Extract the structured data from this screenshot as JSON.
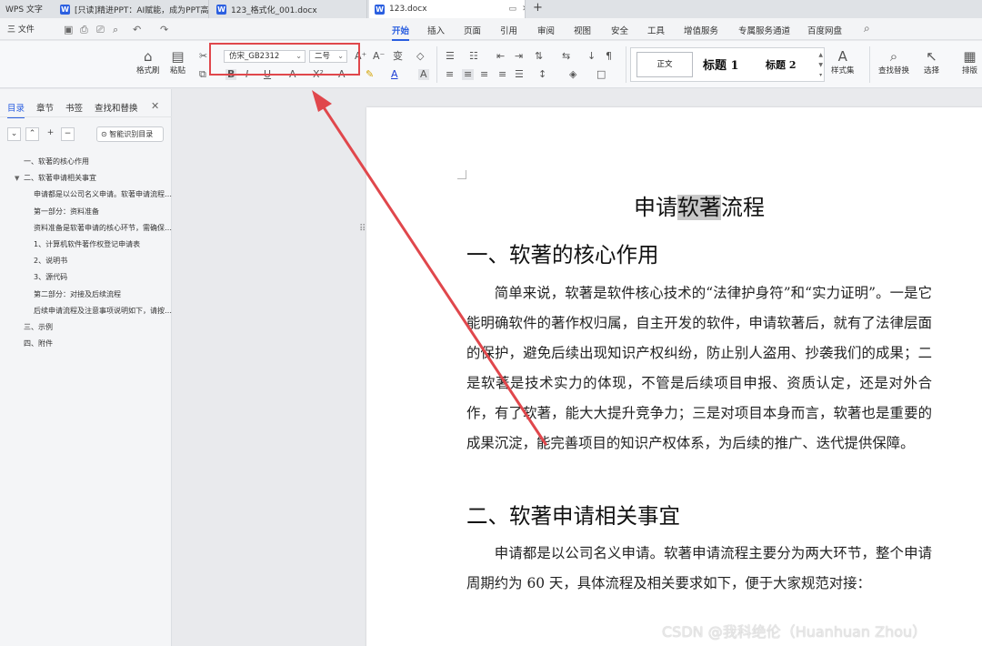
{
  "app_name": "WPS 文字",
  "tabs": [
    {
      "label": "[只读]精进PPT：AI赋能，成为PPT高手",
      "icon": "W"
    },
    {
      "label": "123_格式化_001.docx",
      "icon": "W"
    },
    {
      "label": "123.docx",
      "icon": "W",
      "active": true
    }
  ],
  "menu": {
    "file_label": "三 文件",
    "tabs": [
      "开始",
      "插入",
      "页面",
      "引用",
      "审阅",
      "视图",
      "安全",
      "工具",
      "增值服务",
      "专属服务通道",
      "百度网盘"
    ],
    "active_tab": "开始"
  },
  "ribbon": {
    "format_painter": "格式刷",
    "paste": "粘贴",
    "font_name": "仿宋_GB2312",
    "font_size": "二号",
    "style_normal": "正文",
    "style_h1": "标题 1",
    "style_h2": "标题 2",
    "style_set": "样式集",
    "find_replace": "查找替换",
    "select": "选择",
    "layout": "排版"
  },
  "nav": {
    "tabs": [
      "目录",
      "章节",
      "书签",
      "查找和替换"
    ],
    "active_tab": "目录",
    "smart_toc": "智能识别目录",
    "items": [
      {
        "text": "一、软著的核心作用",
        "level": 1
      },
      {
        "text": "二、软著申请相关事宜",
        "level": 1,
        "expanded": true
      },
      {
        "text": "申请都是以公司名义申请。软著申请流程主要分为两大环节",
        "level": 2
      },
      {
        "text": "第一部分：资料准备",
        "level": 2
      },
      {
        "text": "资料准备是软著申请的核心环节，需确保材料完整规范",
        "level": 2
      },
      {
        "text": "1、计算机软件著作权登记申请表",
        "level": 2
      },
      {
        "text": "2、说明书",
        "level": 2
      },
      {
        "text": "3、源代码",
        "level": 2
      },
      {
        "text": "第二部分：对接及后续流程",
        "level": 2
      },
      {
        "text": "后续申请流程及注意事项说明如下，请按要求对接",
        "level": 2
      },
      {
        "text": "三、示例",
        "level": 1
      },
      {
        "text": "四、附件",
        "level": 1
      }
    ]
  },
  "document": {
    "title_before": "申请",
    "title_selected": "软著",
    "title_after": "流程",
    "h1_1": "一、软著的核心作用",
    "p1": "简单来说，软著是软件核心技术的“法律护身符”和“实力证明”。一是它能明确软件的著作权归属，自主开发的软件，申请软著后，就有了法律层面的保护，避免后续出现知识产权纠纷，防止别人盗用、抄袭我们的成果；二是软著是技术实力的体现，不管是后续项目申报、资质认定，还是对外合作，有了软著，能大大提升竞争力；三是对项目本身而言，软著也是重要的成果沉淀，能完善项目的知识产权体系，为后续的推广、迭代提供保障。",
    "h1_2": "二、软著申请相关事宜",
    "p2": "申请都是以公司名义申请。软著申请流程主要分为两大环节，整个申请周期约为 60 天，具体流程及相关要求如下，便于大家规范对接："
  },
  "watermark": "CSDN @我科绝伦（Huanhuan Zhou）",
  "colors": {
    "accent": "#2b5fe0",
    "annotation": "#e0474c"
  }
}
